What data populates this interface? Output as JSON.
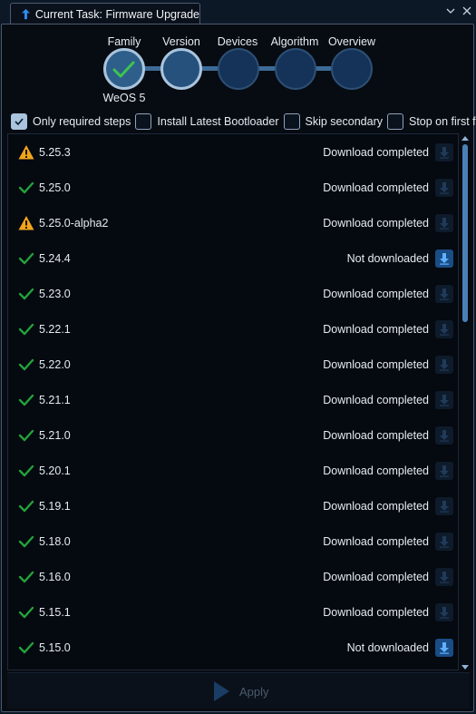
{
  "tab": {
    "title": "Current Task: Firmware Upgrade",
    "icon": "upload-arrow-icon"
  },
  "wizard": {
    "steps": [
      {
        "label": "Family",
        "sublabel": "WeOS 5",
        "state": "done"
      },
      {
        "label": "Version",
        "sublabel": "",
        "state": "current"
      },
      {
        "label": "Devices",
        "sublabel": "",
        "state": "pending"
      },
      {
        "label": "Algorithm",
        "sublabel": "",
        "state": "pending"
      },
      {
        "label": "Overview",
        "sublabel": "",
        "state": "pending"
      }
    ]
  },
  "options": [
    {
      "label": "Only required steps",
      "checked": true
    },
    {
      "label": "Install Latest Bootloader",
      "checked": false
    },
    {
      "label": "Skip secondary",
      "checked": false
    },
    {
      "label": "Stop on first fail",
      "checked": false
    }
  ],
  "versions": [
    {
      "version": "5.25.3",
      "status": "Download completed",
      "icon": "warning",
      "download_enabled": false
    },
    {
      "version": "5.25.0",
      "status": "Download completed",
      "icon": "check",
      "download_enabled": false
    },
    {
      "version": "5.25.0-alpha2",
      "status": "Download completed",
      "icon": "warning",
      "download_enabled": false
    },
    {
      "version": "5.24.4",
      "status": "Not downloaded",
      "icon": "check",
      "download_enabled": true
    },
    {
      "version": "5.23.0",
      "status": "Download completed",
      "icon": "check",
      "download_enabled": false
    },
    {
      "version": "5.22.1",
      "status": "Download completed",
      "icon": "check",
      "download_enabled": false
    },
    {
      "version": "5.22.0",
      "status": "Download completed",
      "icon": "check",
      "download_enabled": false
    },
    {
      "version": "5.21.1",
      "status": "Download completed",
      "icon": "check",
      "download_enabled": false
    },
    {
      "version": "5.21.0",
      "status": "Download completed",
      "icon": "check",
      "download_enabled": false
    },
    {
      "version": "5.20.1",
      "status": "Download completed",
      "icon": "check",
      "download_enabled": false
    },
    {
      "version": "5.19.1",
      "status": "Download completed",
      "icon": "check",
      "download_enabled": false
    },
    {
      "version": "5.18.0",
      "status": "Download completed",
      "icon": "check",
      "download_enabled": false
    },
    {
      "version": "5.16.0",
      "status": "Download completed",
      "icon": "check",
      "download_enabled": false
    },
    {
      "version": "5.15.1",
      "status": "Download completed",
      "icon": "check",
      "download_enabled": false
    },
    {
      "version": "5.15.0",
      "status": "Not downloaded",
      "icon": "check",
      "download_enabled": true
    }
  ],
  "footer": {
    "apply_label": "Apply",
    "apply_enabled": false
  },
  "colors": {
    "background": "#070b12",
    "accent": "#1a4d85",
    "check": "#22a33a",
    "warning": "#f0a51a",
    "step_ring": "#a9c4dc"
  }
}
